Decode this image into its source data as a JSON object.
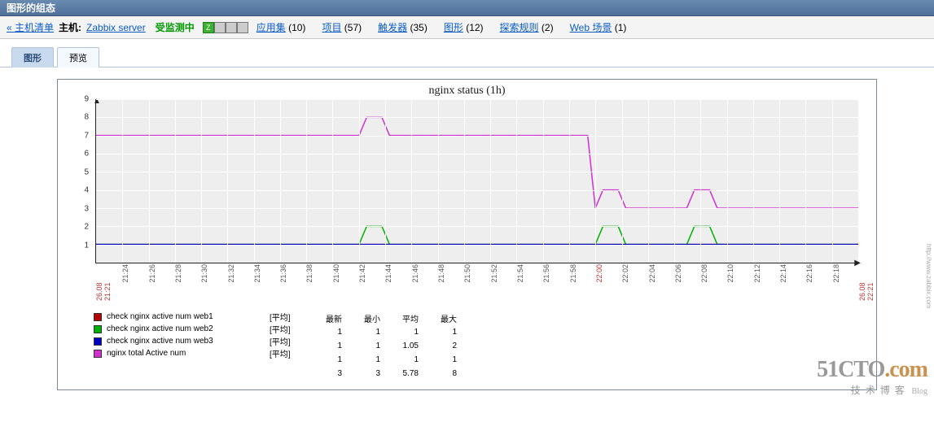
{
  "window_title": "图形的组态",
  "nav": {
    "back_label": "« 主机清单",
    "host_label": "主机:",
    "host_name": "Zabbix server",
    "status": "受监测中",
    "z_label": "Z",
    "items": [
      {
        "label": "应用集",
        "count": "(10)"
      },
      {
        "label": "项目",
        "count": "(57)"
      },
      {
        "label": "触发器",
        "count": "(35)"
      },
      {
        "label": "图形",
        "count": "(12)"
      },
      {
        "label": "探索规则",
        "count": "(2)"
      },
      {
        "label": "Web 场景",
        "count": "(1)"
      }
    ]
  },
  "tabs": [
    {
      "label": "图形",
      "active": true
    },
    {
      "label": "预览",
      "active": false
    }
  ],
  "chart_data": {
    "type": "line",
    "title": "nginx status (1h)",
    "ylim": [
      0,
      9
    ],
    "yticks": [
      1,
      2,
      3,
      4,
      5,
      6,
      7,
      8,
      9
    ],
    "xticks": [
      "26.08 21:21",
      "21:24",
      "21:26",
      "21:28",
      "21:30",
      "21:32",
      "21:34",
      "21:36",
      "21:38",
      "21:40",
      "21:42",
      "21:44",
      "21:46",
      "21:48",
      "21:50",
      "21:52",
      "21:54",
      "21:56",
      "21:58",
      "22:00",
      "22:02",
      "22:04",
      "22:06",
      "22:08",
      "22:10",
      "22:12",
      "22:14",
      "22:16",
      "22:18",
      "26.08 22:21"
    ],
    "xred": [
      0,
      19,
      29
    ],
    "series": [
      {
        "name": "check nginx active num web1",
        "color": "#b00000",
        "agg": "[平均]",
        "last": 1,
        "min": 1,
        "avg": 1,
        "max": 1,
        "points": [
          [
            0,
            1
          ],
          [
            1,
            1
          ]
        ]
      },
      {
        "name": "check nginx active num web2",
        "color": "#00b000",
        "agg": "[平均]",
        "last": 1,
        "min": 1,
        "avg": 1.05,
        "max": 2,
        "points": [
          [
            0,
            1
          ],
          [
            0.345,
            1
          ],
          [
            0.355,
            2
          ],
          [
            0.375,
            2
          ],
          [
            0.385,
            1
          ],
          [
            0.655,
            1
          ],
          [
            0.665,
            2
          ],
          [
            0.685,
            2
          ],
          [
            0.695,
            1
          ],
          [
            0.775,
            1
          ],
          [
            0.785,
            2
          ],
          [
            0.805,
            2
          ],
          [
            0.815,
            1
          ],
          [
            1,
            1
          ]
        ]
      },
      {
        "name": "check nginx active num web3",
        "color": "#0000c0",
        "agg": "[平均]",
        "last": 1,
        "min": 1,
        "avg": 1,
        "max": 1,
        "points": [
          [
            0,
            1
          ],
          [
            1,
            1
          ]
        ]
      },
      {
        "name": "nginx total Active num",
        "color": "#d030d0",
        "agg": "[平均]",
        "last": 3,
        "min": 3,
        "avg": 5.78,
        "max": 8,
        "points": [
          [
            0,
            7
          ],
          [
            0.345,
            7
          ],
          [
            0.355,
            8
          ],
          [
            0.375,
            8
          ],
          [
            0.385,
            7
          ],
          [
            0.645,
            7
          ],
          [
            0.655,
            3
          ],
          [
            0.665,
            4
          ],
          [
            0.685,
            4
          ],
          [
            0.695,
            3
          ],
          [
            0.775,
            3
          ],
          [
            0.785,
            4
          ],
          [
            0.805,
            4
          ],
          [
            0.815,
            3
          ],
          [
            1,
            3
          ]
        ]
      }
    ],
    "legend_headers": [
      "最新",
      "最小",
      "平均",
      "最大"
    ]
  },
  "watermark": {
    "main": "51CTO",
    "dom": ".com",
    "sub": "技术博客",
    "blog": "Blog"
  },
  "side_credit": "http://www.zabbix.com"
}
